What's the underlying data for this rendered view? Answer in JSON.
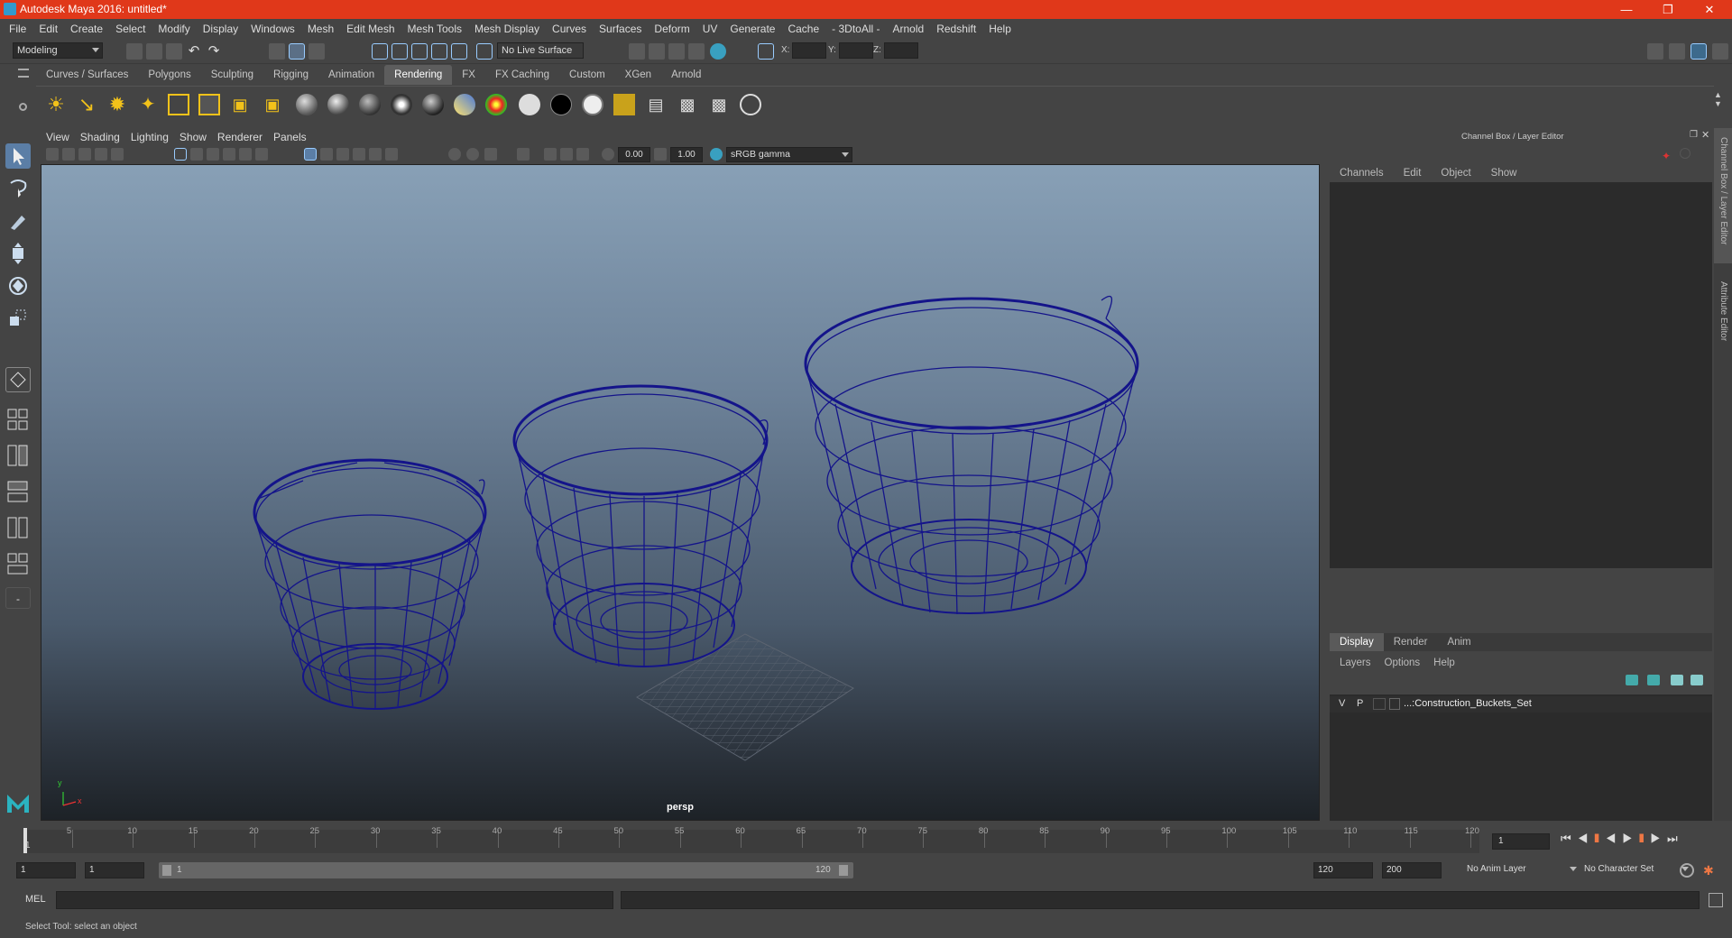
{
  "window": {
    "title": "Autodesk Maya 2016: untitled*"
  },
  "menus": [
    "File",
    "Edit",
    "Create",
    "Select",
    "Modify",
    "Display",
    "Windows",
    "Mesh",
    "Edit Mesh",
    "Mesh Tools",
    "Mesh Display",
    "Curves",
    "Surfaces",
    "Deform",
    "UV",
    "Generate",
    "Cache",
    "- 3DtoAll -",
    "Arnold",
    "Redshift",
    "Help"
  ],
  "statusline": {
    "workspace": "Modeling",
    "live_surface": "No Live Surface",
    "x_label": "X:",
    "y_label": "Y:",
    "z_label": "Z:"
  },
  "shelf": {
    "tabs": [
      "Curves / Surfaces",
      "Polygons",
      "Sculpting",
      "Rigging",
      "Animation",
      "Rendering",
      "FX",
      "FX Caching",
      "Custom",
      "XGen",
      "Arnold"
    ],
    "active_tab": "Rendering"
  },
  "viewport": {
    "menus": [
      "View",
      "Shading",
      "Lighting",
      "Show",
      "Renderer",
      "Panels"
    ],
    "exposure": "0.00",
    "gamma": "1.00",
    "color_space": "sRGB gamma",
    "camera": "persp",
    "axis_y": "y",
    "axis_x": "x"
  },
  "channel_box": {
    "header": "Channel Box / Layer Editor",
    "menus": [
      "Channels",
      "Edit",
      "Object",
      "Show"
    ]
  },
  "layer_editor": {
    "tabs": [
      "Display",
      "Render",
      "Anim"
    ],
    "active_tab": "Display",
    "menus": [
      "Layers",
      "Options",
      "Help"
    ],
    "layer": {
      "v": "V",
      "p": "P",
      "name": "...:Construction_Buckets_Set"
    }
  },
  "side_tabs": {
    "channel_box": "Channel Box / Layer Editor",
    "attribute_editor": "Attribute Editor"
  },
  "timeline": {
    "ticks": [
      5,
      10,
      15,
      20,
      25,
      30,
      35,
      40,
      45,
      50,
      55,
      60,
      65,
      70,
      75,
      80,
      85,
      90,
      95,
      100,
      105,
      110,
      115,
      120
    ],
    "current_frame_marker": "1",
    "current_frame": "1"
  },
  "range": {
    "start": "1",
    "playback_start": "1",
    "slider_start": "1",
    "slider_end": "120",
    "playback_end": "120",
    "end": "200",
    "anim_layer": "No Anim Layer",
    "character_set": "No Character Set"
  },
  "command": {
    "label": "MEL"
  },
  "help_line": "Select Tool: select an object",
  "colors": {
    "title_bar": "#e0381a",
    "wireframe": "#1a1a8c",
    "accent_tab": "#5d5d5d"
  }
}
